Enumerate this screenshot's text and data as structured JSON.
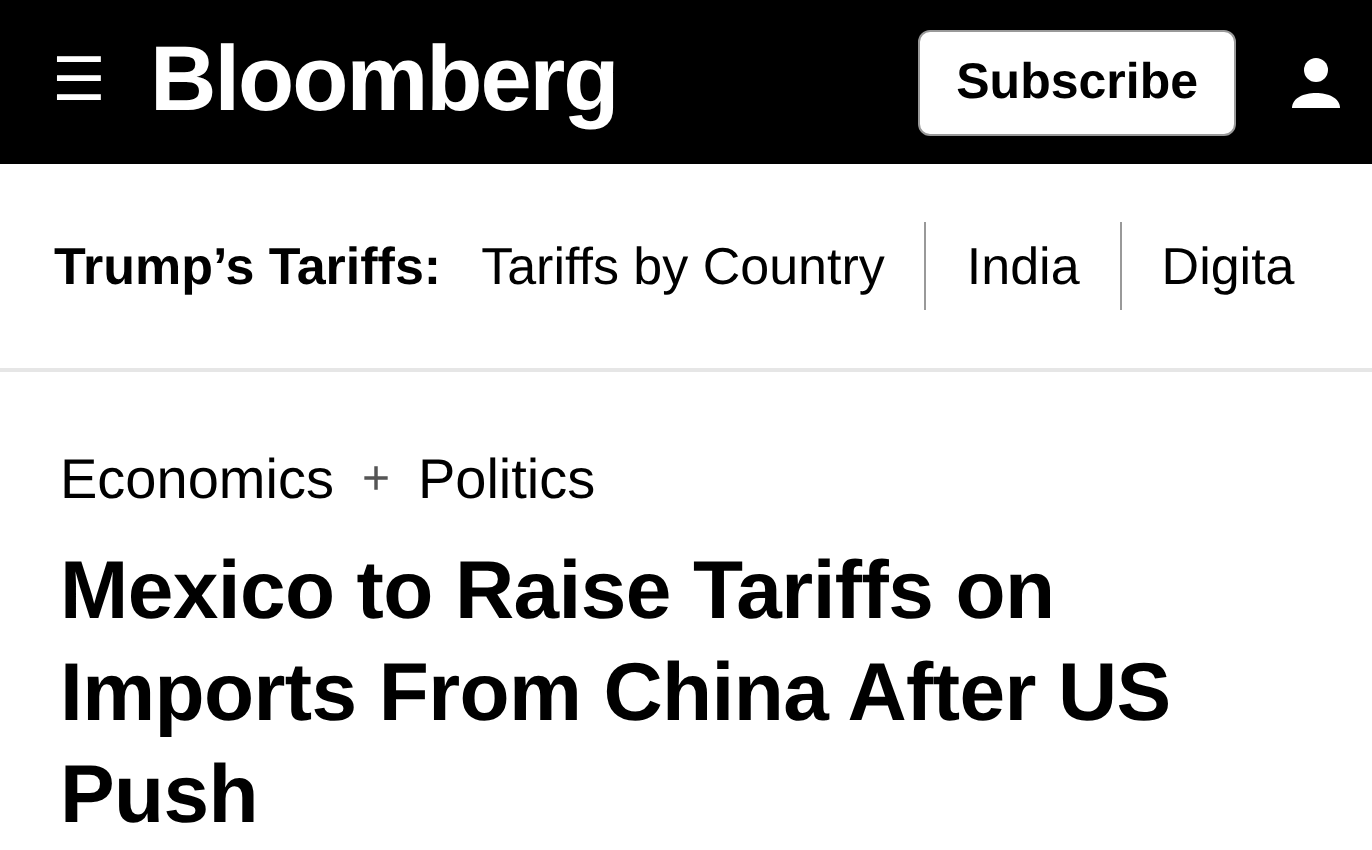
{
  "header": {
    "menu_icon": "☰",
    "logo": "Bloomberg",
    "subscribe_button": "Subscribe"
  },
  "topic_nav": {
    "label": "Trump’s Tariffs:",
    "links": [
      "Tariffs by Country",
      "India",
      "Digita"
    ]
  },
  "article": {
    "categories": [
      "Economics",
      "Politics"
    ],
    "separator": "+",
    "headline": "Mexico to Raise Tariffs on Imports From China After US Push"
  }
}
